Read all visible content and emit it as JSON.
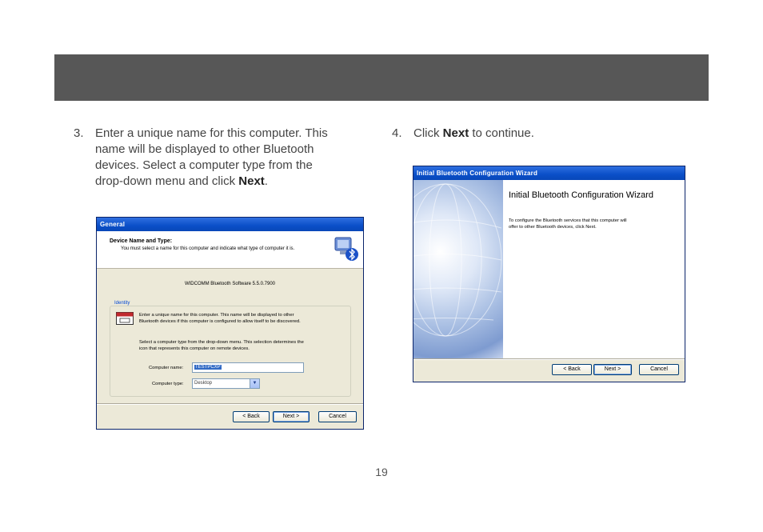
{
  "page_number": "19",
  "steps": [
    {
      "number": "3.",
      "lines": [
        "Enter a unique name for this computer.  This",
        "name will be displayed to other Bluetooth",
        "devices.  Select a computer type from the"
      ],
      "last_line_prefix": "drop-down menu and click ",
      "last_line_bold": "Next",
      "last_line_suffix": "."
    },
    {
      "number": "4.",
      "prefix": "Click ",
      "bold": "Next",
      "suffix": " to continue."
    }
  ],
  "general_dialog": {
    "title": "General",
    "header_title": "Device Name and Type:",
    "header_subtitle": "You must select a name for this computer and indicate what type of computer it is.",
    "version": "WIDCOMM Bluetooth Software 5.5.0.7900",
    "group_label": "Identity",
    "identity_text_1": "Enter a unique name for this computer.  This name will be displayed to other",
    "identity_text_2": "Bluetooth devices if this computer is configured to allow itself to be discovered.",
    "type_text_1": "Select a computer type from the drop-down menu.  This selection determines the",
    "type_text_2": "icon that represents this computer on remote devices.",
    "name_label": "Computer name:",
    "name_value": "TESTPCXP",
    "type_label": "Computer type:",
    "type_value": "Desktop",
    "buttons": {
      "back": "< Back",
      "next": "Next >",
      "cancel": "Cancel"
    }
  },
  "wizard_dialog": {
    "title": "Initial Bluetooth Configuration Wizard",
    "heading": "Initial Bluetooth Configuration Wizard",
    "desc_1": "To configure the Bluetooth services that this computer will",
    "desc_2": "offer to other Bluetooth devices, click Next.",
    "buttons": {
      "back": "< Back",
      "next": "Next >",
      "cancel": "Cancel"
    }
  },
  "colors": {
    "band": "#575757",
    "xp_title": "#0a4fc8",
    "dialog_bg": "#ece9d8"
  }
}
